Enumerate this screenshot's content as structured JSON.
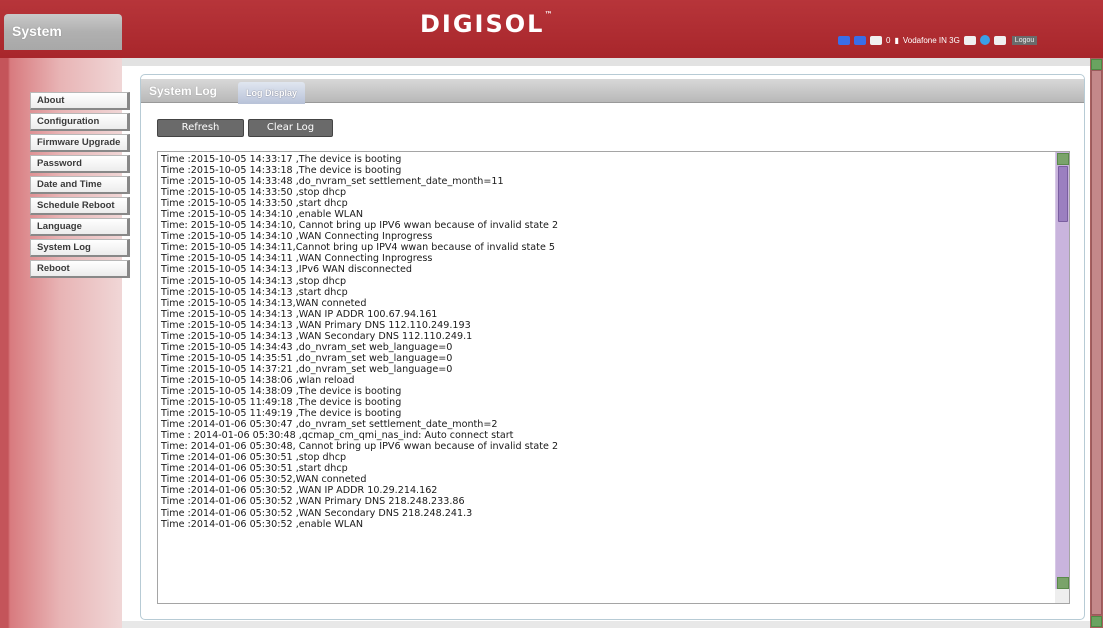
{
  "header": {
    "section_title": "System",
    "logo_text": "DIGISOL",
    "logo_mark": "™",
    "status": {
      "sms_count": "0",
      "network": "Vodafone IN 3G",
      "logout_label": "Logou"
    }
  },
  "sidebar": {
    "items": [
      {
        "label": "About"
      },
      {
        "label": "Configuration"
      },
      {
        "label": "Firmware Upgrade"
      },
      {
        "label": "Password"
      },
      {
        "label": "Date and Time"
      },
      {
        "label": "Schedule Reboot"
      },
      {
        "label": "Language"
      },
      {
        "label": "System Log"
      },
      {
        "label": "Reboot"
      }
    ]
  },
  "panel": {
    "title": "System Log",
    "tab": "Log Display",
    "refresh_label": "Refresh",
    "clear_label": "Clear Log"
  },
  "log": {
    "lines": [
      "Time :2015-10-05 14:33:17 ,The device is booting",
      "Time :2015-10-05 14:33:18 ,The device is booting",
      "Time :2015-10-05 14:33:48 ,do_nvram_set settlement_date_month=11",
      "Time :2015-10-05 14:33:50 ,stop dhcp",
      "Time :2015-10-05 14:33:50 ,start dhcp",
      "Time :2015-10-05 14:34:10 ,enable WLAN",
      "Time: 2015-10-05 14:34:10, Cannot bring up IPV6 wwan because of invalid state 2",
      "Time :2015-10-05 14:34:10 ,WAN Connecting Inprogress",
      "Time: 2015-10-05 14:34:11,Cannot bring up IPV4 wwan because of invalid state 5",
      "Time :2015-10-05 14:34:11 ,WAN Connecting Inprogress",
      "Time :2015-10-05 14:34:13 ,IPv6 WAN disconnected",
      "Time :2015-10-05 14:34:13 ,stop dhcp",
      "Time :2015-10-05 14:34:13 ,start dhcp",
      "Time :2015-10-05 14:34:13,WAN conneted",
      "Time :2015-10-05 14:34:13 ,WAN IP ADDR 100.67.94.161",
      "Time :2015-10-05 14:34:13 ,WAN Primary DNS 112.110.249.193",
      "Time :2015-10-05 14:34:13 ,WAN Secondary DNS 112.110.249.1",
      "Time :2015-10-05 14:34:43 ,do_nvram_set web_language=0",
      "Time :2015-10-05 14:35:51 ,do_nvram_set web_language=0",
      "Time :2015-10-05 14:37:21 ,do_nvram_set web_language=0",
      "Time :2015-10-05 14:38:06 ,wlan reload",
      "Time :2015-10-05 14:38:09 ,The device is booting",
      "Time :2015-10-05 11:49:18 ,The device is booting",
      "Time :2015-10-05 11:49:19 ,The device is booting",
      "Time :2014-01-06 05:30:47 ,do_nvram_set settlement_date_month=2",
      "Time : 2014-01-06 05:30:48 ,qcmap_cm_qmi_nas_ind: Auto connect start",
      "Time: 2014-01-06 05:30:48, Cannot bring up IPV6 wwan because of invalid state 2",
      "Time :2014-01-06 05:30:51 ,stop dhcp",
      "Time :2014-01-06 05:30:51 ,start dhcp",
      "Time :2014-01-06 05:30:52,WAN conneted",
      "Time :2014-01-06 05:30:52 ,WAN IP ADDR 10.29.214.162",
      "Time :2014-01-06 05:30:52 ,WAN Primary DNS 218.248.233.86",
      "Time :2014-01-06 05:30:52 ,WAN Secondary DNS 218.248.241.3",
      "Time :2014-01-06 05:30:52 ,enable WLAN"
    ]
  },
  "colors": {
    "header_red": "#a8262b",
    "menu_border": "#888888",
    "scroll_purple": "#c9b4dd"
  }
}
